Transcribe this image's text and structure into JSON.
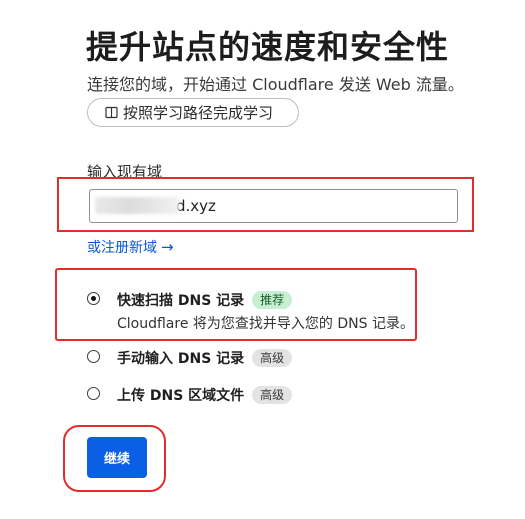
{
  "header": {
    "title": "提升站点的速度和安全性",
    "subtitle": "连接您的域，开始通过 Cloudflare 发送 Web 流量。",
    "learn_button_label": "按照学习路径完成学习"
  },
  "domain_form": {
    "label": "输入现有域",
    "value": "d.xyz",
    "register_link": "或注册新域",
    "register_arrow": "→"
  },
  "options": [
    {
      "title": "快速扫描 DNS 记录",
      "badge": "推荐",
      "description": "Cloudflare 将为您查找并导入您的 DNS 记录。",
      "checked": true
    },
    {
      "title": "手动输入 DNS 记录",
      "badge": "高级",
      "checked": false
    },
    {
      "title": "上传 DNS 区域文件",
      "badge": "高级",
      "checked": false
    }
  ],
  "actions": {
    "continue_label": "继续"
  },
  "colors": {
    "primary": "#0b5fe6",
    "link": "#0a58d0",
    "annotation_red": "#e52b2b",
    "recommend_badge_bg": "#c9efd2",
    "advanced_badge_bg": "#e3e3e3"
  }
}
